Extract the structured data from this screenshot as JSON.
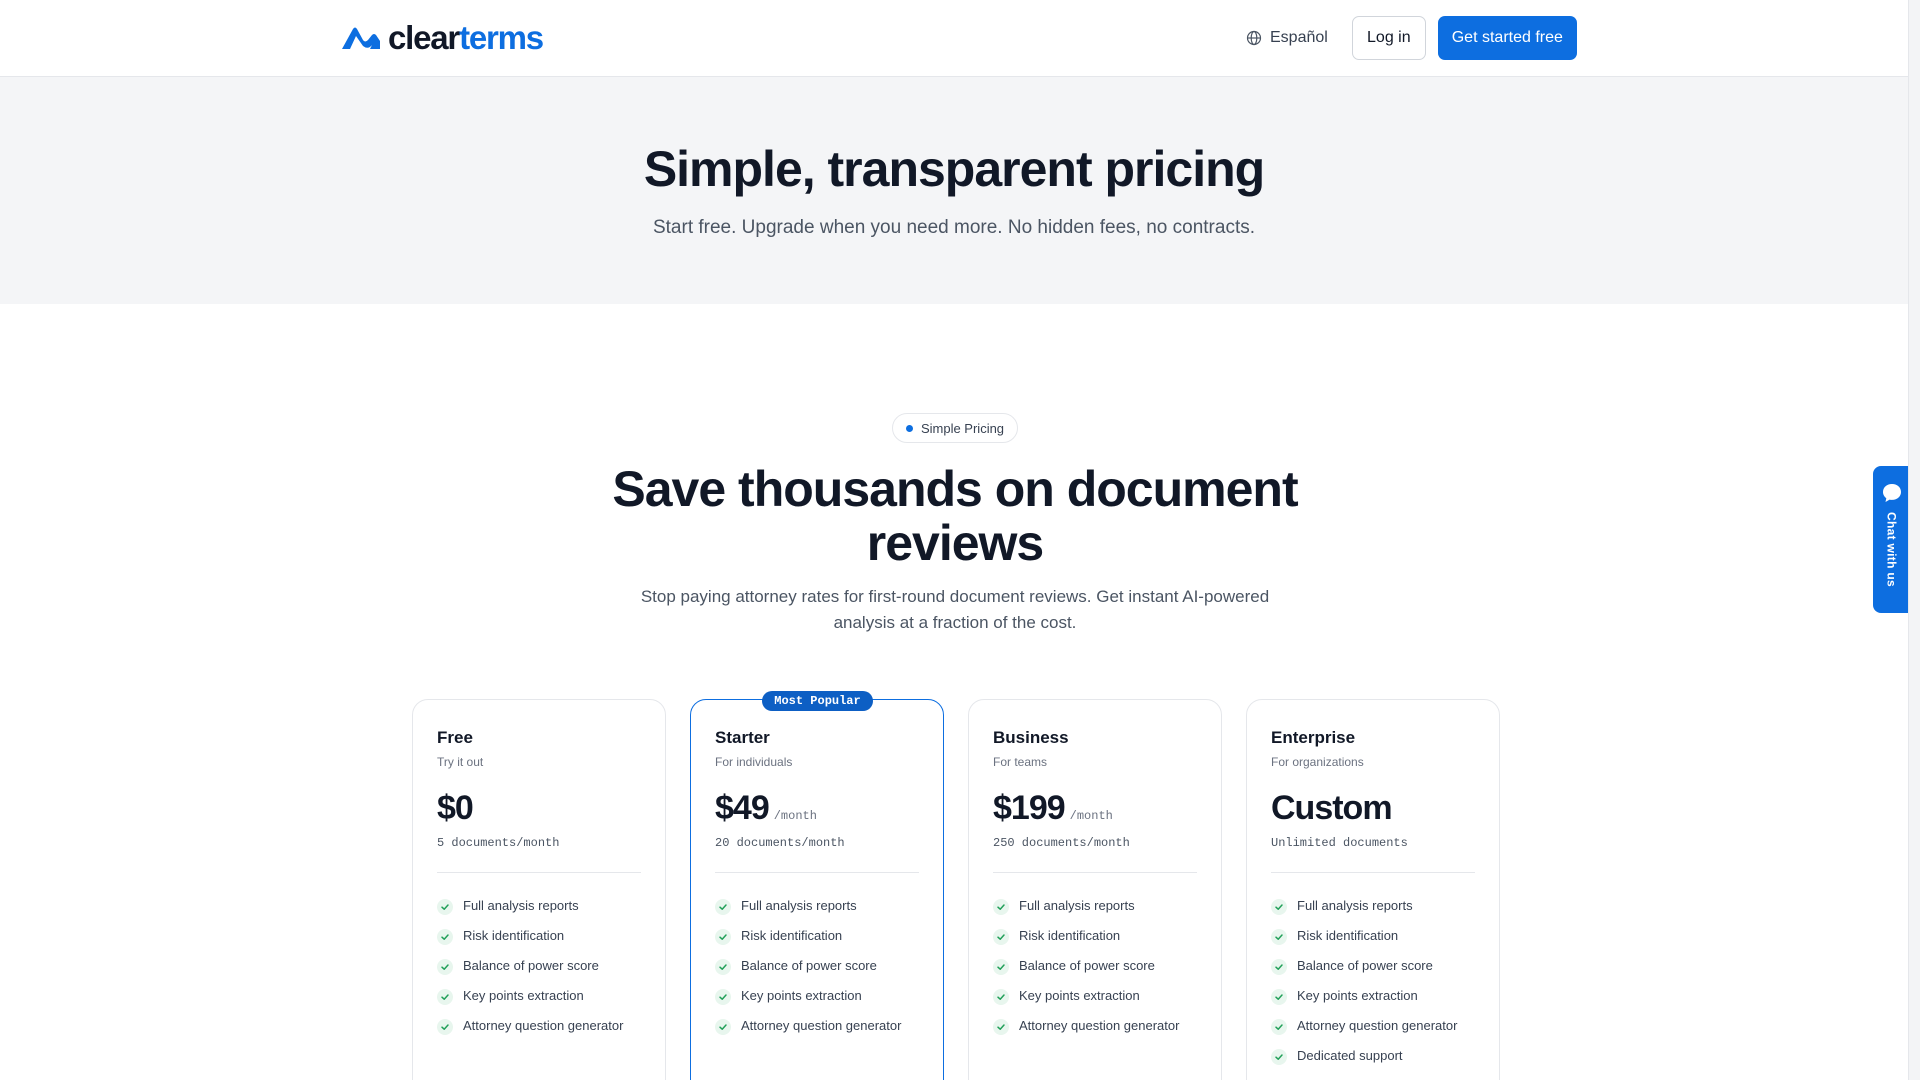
{
  "header": {
    "logo": {
      "part1": "clear",
      "part2": "terms"
    },
    "language": "Español",
    "login_label": "Log in",
    "cta_label": "Get started free"
  },
  "hero": {
    "title": "Simple, transparent pricing",
    "subtitle": "Start free. Upgrade when you need more. No hidden fees, no contracts."
  },
  "pricing": {
    "pill": "Simple Pricing",
    "title": "Save thousands on document reviews",
    "subtitle": "Stop paying attorney rates for first-round document reviews. Get instant AI-powered analysis at a fraction of the cost.",
    "plans": [
      {
        "name": "Free",
        "tagline": "Try it out",
        "price": "$0",
        "period": "",
        "documents": "5 documents/month",
        "features": [
          "Full analysis reports",
          "Risk identification",
          "Balance of power score",
          "Key points extraction",
          "Attorney question generator"
        ]
      },
      {
        "name": "Starter",
        "tagline": "For individuals",
        "badge": "Most Popular",
        "price": "$49",
        "period": "/month",
        "documents": "20 documents/month",
        "features": [
          "Full analysis reports",
          "Risk identification",
          "Balance of power score",
          "Key points extraction",
          "Attorney question generator"
        ]
      },
      {
        "name": "Business",
        "tagline": "For teams",
        "price": "$199",
        "period": "/month",
        "documents": "250 documents/month",
        "features": [
          "Full analysis reports",
          "Risk identification",
          "Balance of power score",
          "Key points extraction",
          "Attorney question generator"
        ]
      },
      {
        "name": "Enterprise",
        "tagline": "For organizations",
        "price": "Custom",
        "period": "",
        "documents": "Unlimited documents",
        "features": [
          "Full analysis reports",
          "Risk identification",
          "Balance of power score",
          "Key points extraction",
          "Attorney question generator",
          "Dedicated support"
        ]
      }
    ]
  },
  "chat": {
    "label": "Chat with us"
  },
  "icons": {
    "logo": "clearterms-logo-mark",
    "language": "globe-icon",
    "feature": "check-icon",
    "chat": "chat-bubble-icon"
  },
  "colors": {
    "accent": "#0d6ee0",
    "hero_bg": "#f4f5f7",
    "check_bg": "#e8f6ee",
    "check": "#22a05a"
  }
}
